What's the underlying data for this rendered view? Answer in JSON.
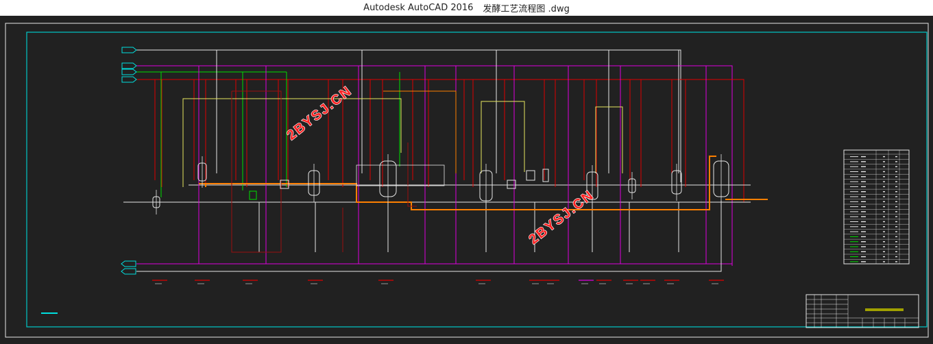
{
  "window": {
    "app_name": "Autodesk AutoCAD 2016",
    "file_name": "发酵工艺流程图 .dwg"
  },
  "watermarks": [
    "2BYSJ.CN",
    "2BYSJ.CN"
  ],
  "colors": {
    "background": "#212121",
    "frame": "#00c8c8",
    "red": "#e00000",
    "magenta": "#e000e0",
    "green": "#00e000",
    "yellow": "#e8e860",
    "white": "#e8e8e8",
    "orange": "#ff8000",
    "darkred": "#9a1010"
  }
}
